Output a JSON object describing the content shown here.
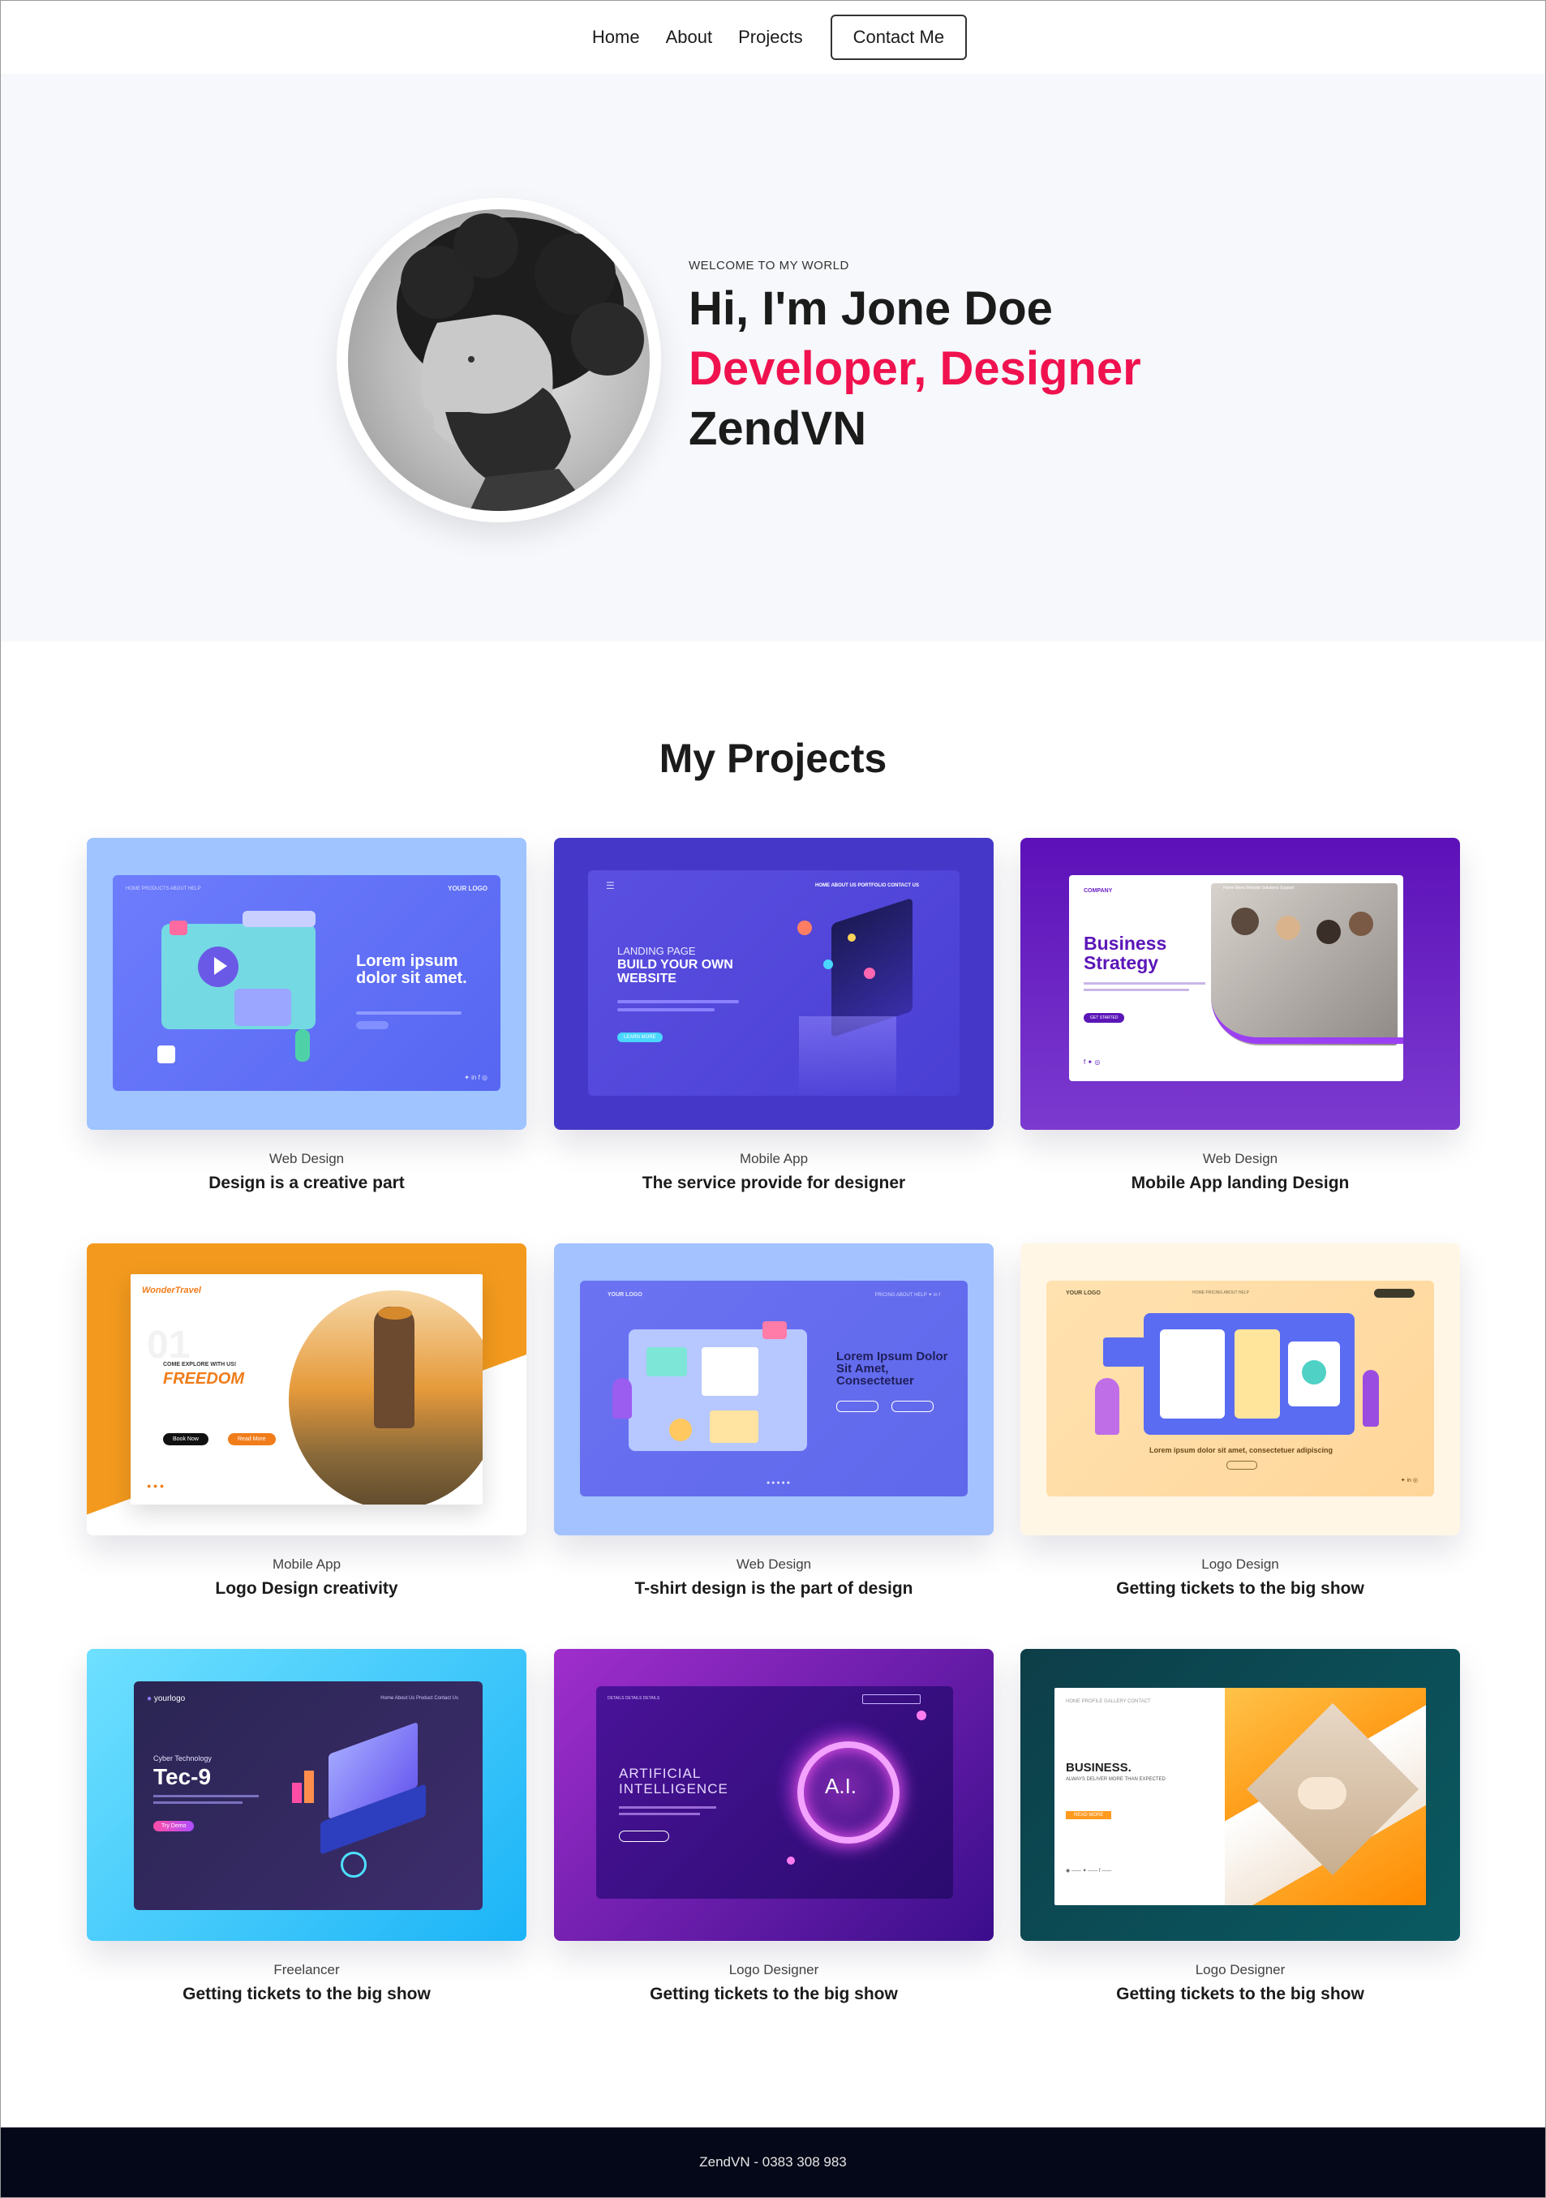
{
  "nav": {
    "items": [
      "Home",
      "About",
      "Projects"
    ],
    "contact_label": "Contact Me"
  },
  "hero": {
    "welcome": "WELCOME TO MY WORLD",
    "line1": "Hi, I'm Jone Doe",
    "line2": "Developer, Designer",
    "line3": "ZendVN"
  },
  "projects": {
    "title": "My Projects",
    "cards": [
      {
        "category": "Web Design",
        "title": "Design is a creative part",
        "thumb_text": "Lorem ipsum dolor sit amet.",
        "logo": "YOUR LOGO"
      },
      {
        "category": "Mobile App",
        "title": "The service provide for designer",
        "thumb_text": "LANDING PAGE",
        "thumb_text2": "BUILD YOUR OWN WEBSITE",
        "button": "LEARN MORE"
      },
      {
        "category": "Web Design",
        "title": "Mobile App landing Design",
        "thumb_text": "Business Strategy",
        "logo": "COMPANY",
        "button": "GET STARTED"
      },
      {
        "category": "Mobile App",
        "title": "Logo Design creativity",
        "thumb_text": "FREEDOM",
        "logo": "WonderTravel",
        "sub": "COME EXPLORE WITH US!",
        "button": "Book Now",
        "button2": "Read More"
      },
      {
        "category": "Web Design",
        "title": "T-shirt design is the part of design",
        "thumb_text": "Lorem Ipsum Dolor Sit Amet, Consectetuer",
        "logo": "YOUR LOGO"
      },
      {
        "category": "Logo Design",
        "title": "Getting tickets to the big show",
        "thumb_text": "Lorem ipsum dolor sit amet, consectetuer adipiscing",
        "logo": "YOUR LOGO"
      },
      {
        "category": "Freelancer",
        "title": "Getting tickets to the big show",
        "thumb_text": "Tec-9",
        "sub": "Cyber Technology",
        "logo": "yourlogo",
        "button": "Try Demo"
      },
      {
        "category": "Logo Designer",
        "title": "Getting tickets to the big show",
        "thumb_text": "ARTIFICIAL INTELLIGENCE",
        "sub": "A.I."
      },
      {
        "category": "Logo Designer",
        "title": "Getting tickets to the big show",
        "thumb_text": "BUSINESS.",
        "sub": "ALWAYS DELIVER MORE THAN EXPECTED",
        "button": "READ MORE"
      }
    ]
  },
  "footer": {
    "text": "ZendVN - 0383 308 983"
  },
  "colors": {
    "accent": "#f0124f",
    "footer_bg": "#050818",
    "hero_bg": "#f6f8fb"
  }
}
